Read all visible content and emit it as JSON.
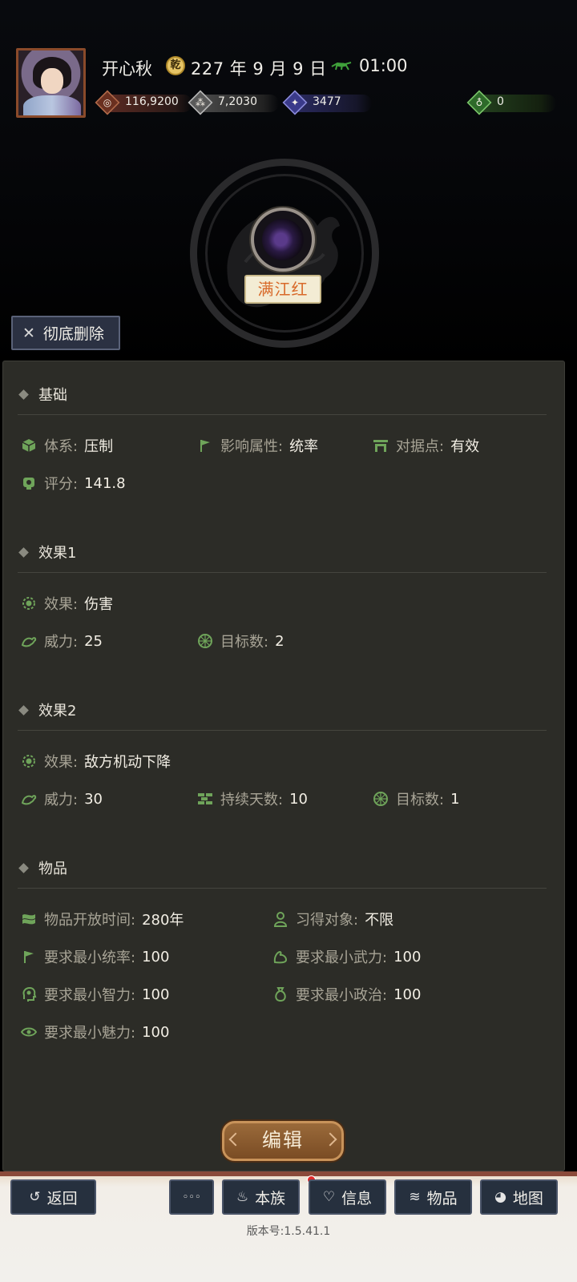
{
  "header": {
    "player_name": "开心秋",
    "date": "227 年 9 月 9 日",
    "time": "01:00",
    "date_icon_glyph": "乾",
    "resources": [
      {
        "icon": "coin-icon",
        "value": "116,9200",
        "color": "#7a3a2a"
      },
      {
        "icon": "grain-icon",
        "value": "7,2030",
        "color": "#6a6a6a"
      },
      {
        "icon": "troops-icon",
        "value": "3477",
        "color": "#3a3a8a"
      },
      {
        "icon": "gourd-icon",
        "value": "0",
        "color": "#2e6a2a"
      }
    ]
  },
  "skill": {
    "name": "满江红",
    "delete_label": "彻底删除",
    "delete_icon": "close-icon"
  },
  "sections": {
    "basic": {
      "title": "基础",
      "system_label": "体系:",
      "system_value": "压制",
      "attr_label": "影响属性:",
      "attr_value": "统率",
      "stronghold_label": "对据点:",
      "stronghold_value": "有效",
      "score_label": "评分:",
      "score_value": "141.8"
    },
    "effect1": {
      "title": "效果1",
      "effect_label": "效果:",
      "effect_value": "伤害",
      "power_label": "威力:",
      "power_value": "25",
      "targets_label": "目标数:",
      "targets_value": "2"
    },
    "effect2": {
      "title": "效果2",
      "effect_label": "效果:",
      "effect_value": "敌方机动下降",
      "power_label": "威力:",
      "power_value": "30",
      "days_label": "持续天数:",
      "days_value": "10",
      "targets_label": "目标数:",
      "targets_value": "1"
    },
    "item": {
      "title": "物品",
      "open_time_label": "物品开放时间:",
      "open_time_value": "280年",
      "learner_label": "习得对象:",
      "learner_value": "不限",
      "min_lead_label": "要求最小统率:",
      "min_lead_value": "100",
      "min_war_label": "要求最小武力:",
      "min_war_value": "100",
      "min_int_label": "要求最小智力:",
      "min_int_value": "100",
      "min_pol_label": "要求最小政治:",
      "min_pol_value": "100",
      "min_cha_label": "要求最小魅力:",
      "min_cha_value": "100"
    }
  },
  "edit_label": "编辑",
  "nav": {
    "back": "返回",
    "more": "◦◦◦",
    "clan": "本族",
    "info": "信息",
    "items": "物品",
    "map": "地图"
  },
  "version": "版本号:1.5.41.1",
  "colors": {
    "panel_bg": "#2c2c27",
    "icon_green": "#6fa45a",
    "accent_orange": "#d86a2a",
    "edit_button": "#8a5a30"
  }
}
